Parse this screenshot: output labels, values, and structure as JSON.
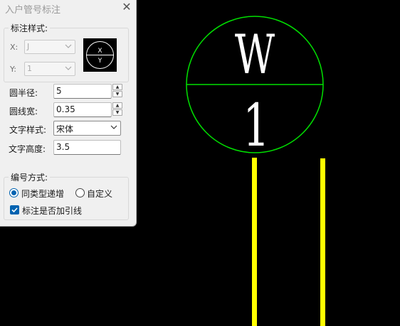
{
  "dialog": {
    "title": "入户管号标注",
    "style_group": {
      "title": "标注样式:",
      "x_label": "X:",
      "x_value": "J",
      "y_label": "Y:",
      "y_value": "1",
      "preview_x": "X",
      "preview_y": "Y"
    },
    "radius_label": "圆半径:",
    "radius_value": "5",
    "linewidth_label": "圆线宽:",
    "linewidth_value": "0.35",
    "textstyle_label": "文字样式:",
    "textstyle_value": "宋体",
    "textheight_label": "文字高度:",
    "textheight_value": "3.5",
    "numbering_group": {
      "title": "编号方式:",
      "option_incremental": "同类型递增",
      "option_custom": "自定义",
      "selected": "同类型递增",
      "leader_label": "标注是否加引线",
      "leader_checked": true
    }
  },
  "drawing": {
    "circle_color": "#00e000",
    "pipe_color": "#ffff00",
    "top_text": "W",
    "bottom_text": "1"
  }
}
